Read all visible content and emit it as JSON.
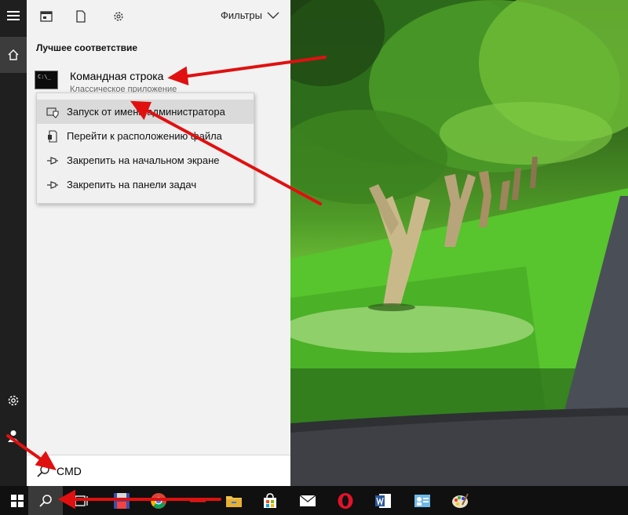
{
  "panel": {
    "filters_label": "Фильтры",
    "best_match_heading": "Лучшее соответствие",
    "result": {
      "title": "Командная строка",
      "subtitle": "Классическое приложение",
      "icon_text": "C:\\_"
    }
  },
  "context_menu": {
    "items": [
      {
        "label": "Запуск от имени администратора",
        "icon": "shield-icon"
      },
      {
        "label": "Перейти к расположению файла",
        "icon": "file-location-icon"
      },
      {
        "label": "Закрепить на начальном экране",
        "icon": "pin-icon"
      },
      {
        "label": "Закрепить на панели задач",
        "icon": "pin-icon"
      }
    ]
  },
  "search": {
    "value": "CMD"
  },
  "colors": {
    "panel_bg": "#f2f2f2",
    "taskbar_bg": "#101010",
    "rail_bg": "#1f1f1f",
    "arrow": "#e01010"
  },
  "taskbar": {
    "items": [
      "windows-start-icon",
      "search-icon",
      "task-view-icon",
      "floppy-icon",
      "chrome-icon",
      "arrow-icon",
      "folder-icon",
      "store-icon",
      "mail-icon",
      "opera-icon",
      "word-icon",
      "contact-card-icon",
      "paint-icon"
    ]
  }
}
